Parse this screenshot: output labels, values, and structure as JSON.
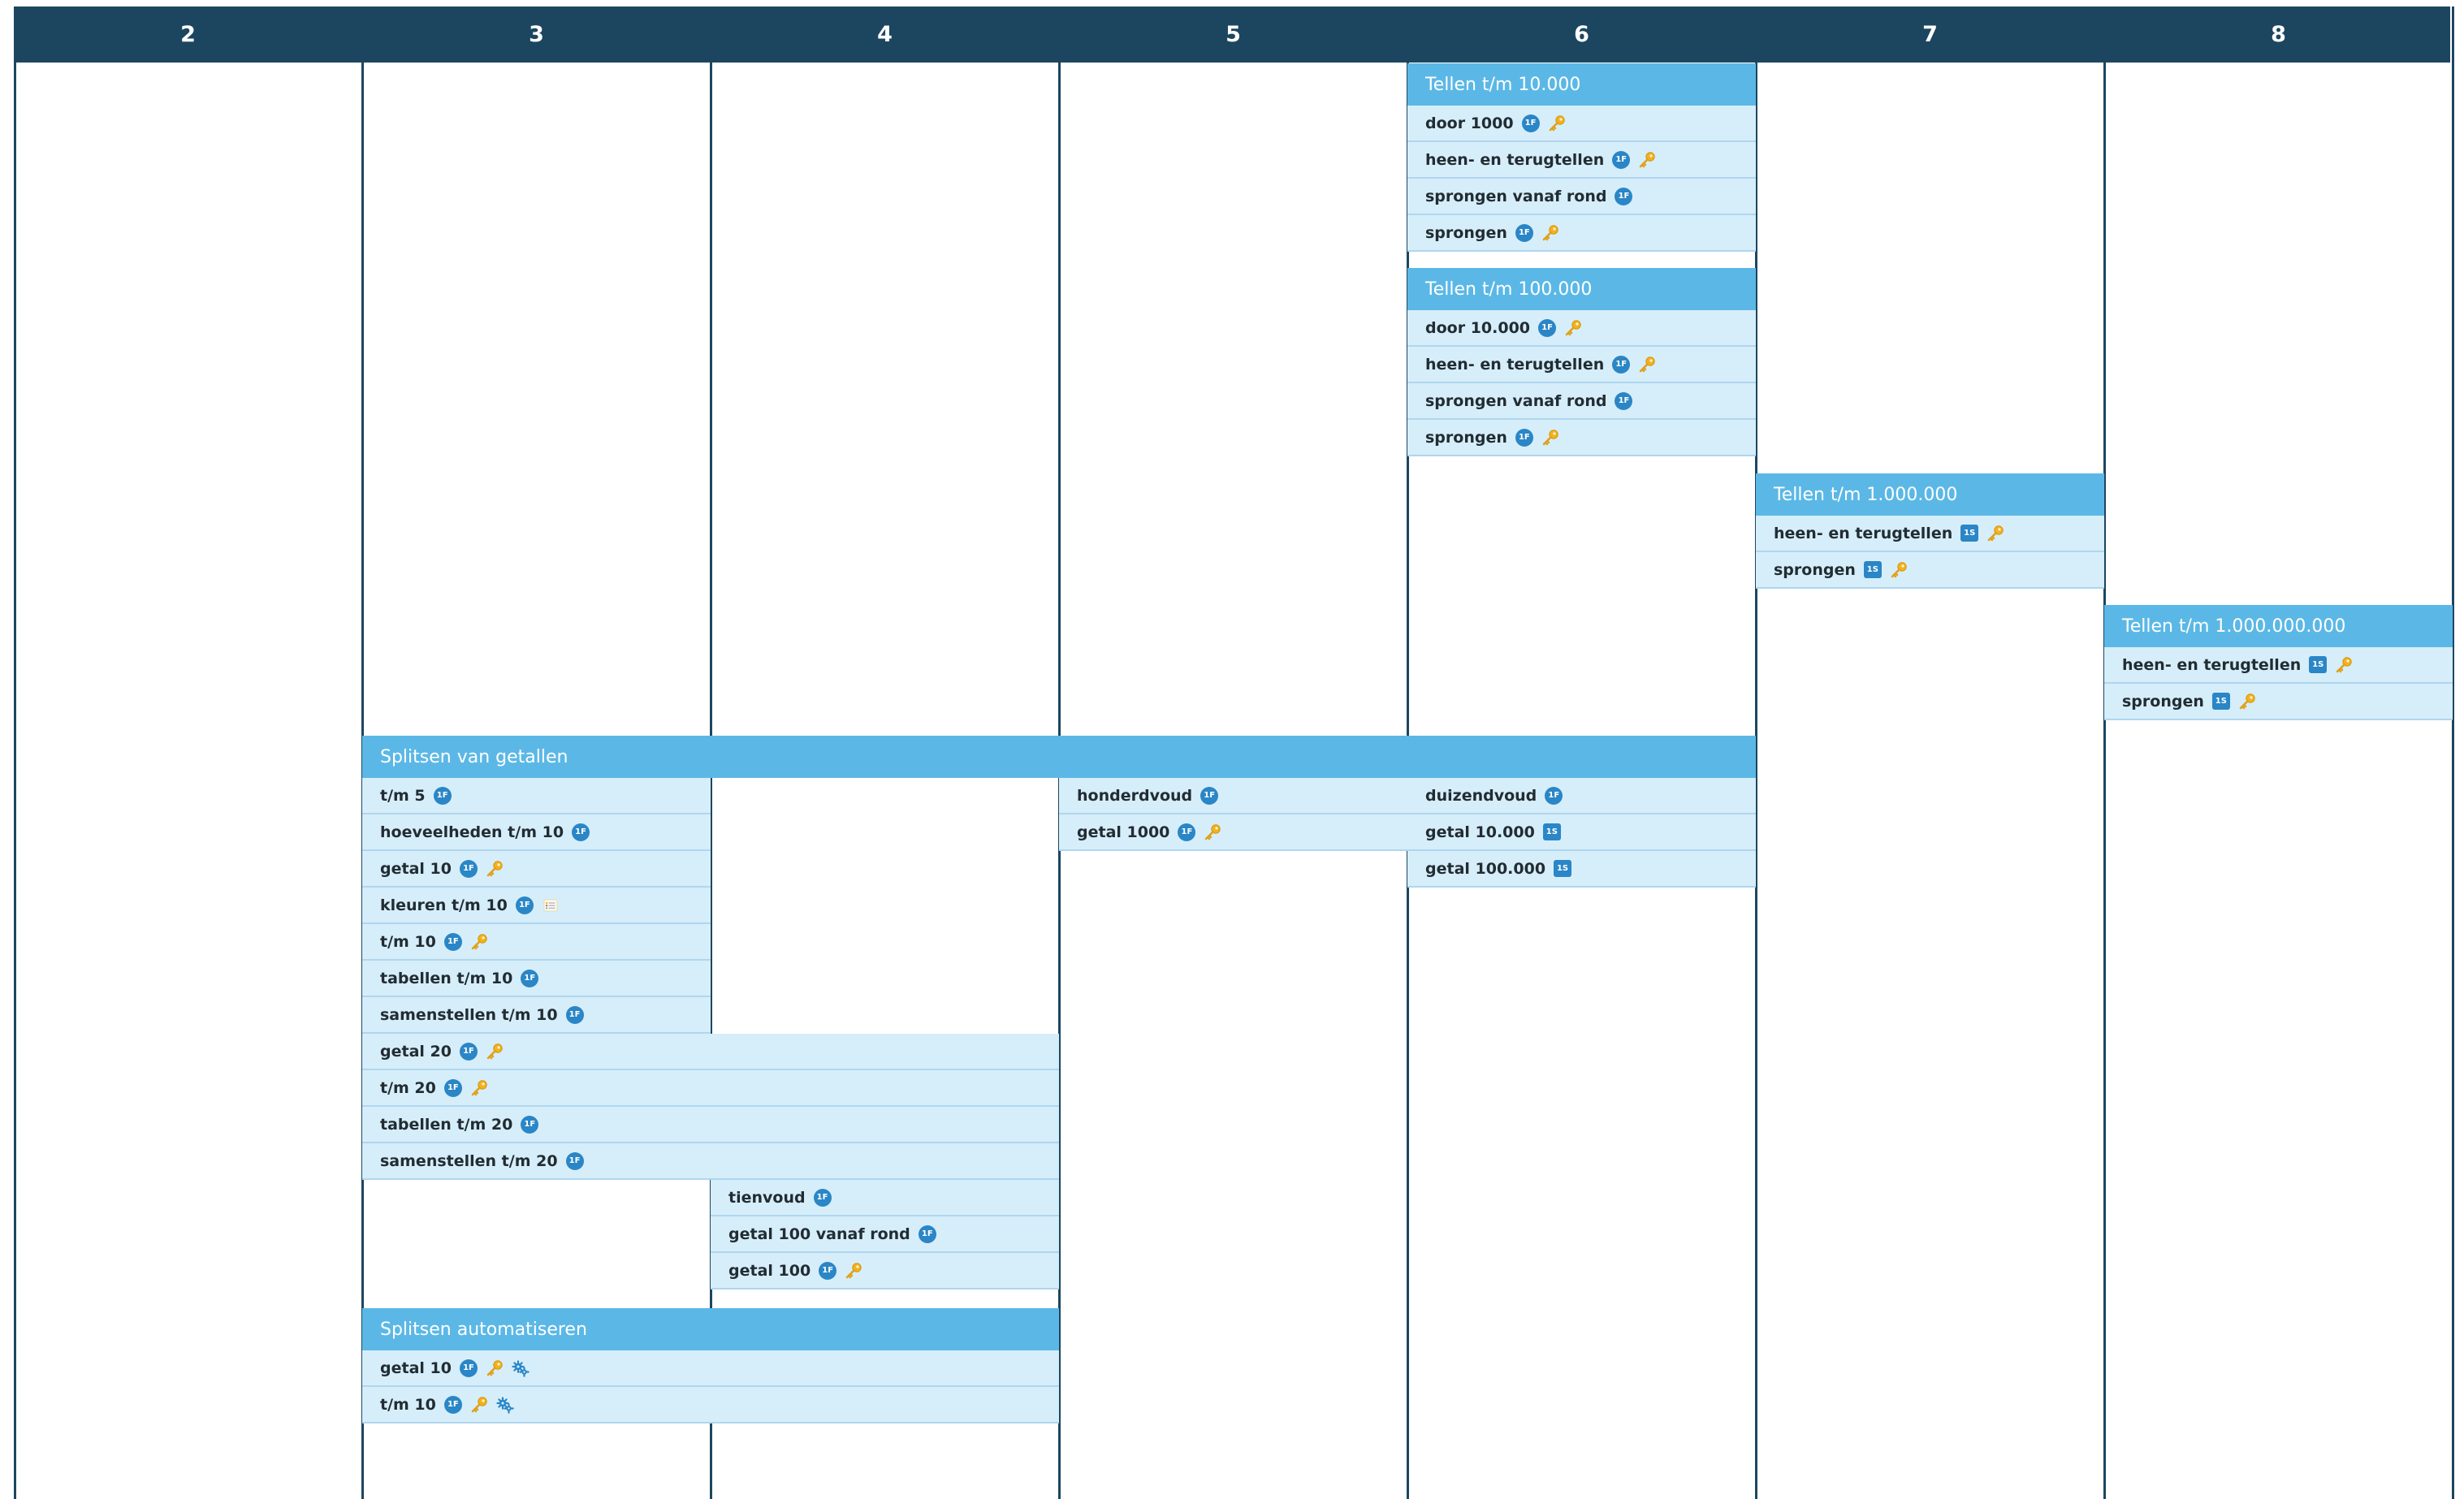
{
  "columns": [
    "2",
    "3",
    "4",
    "5",
    "6",
    "7",
    "8"
  ],
  "groups": {
    "tellen_10000": {
      "title": "Tellen t/m 10.000",
      "items": [
        {
          "label": "door 1000",
          "icons": [
            "circle-badge",
            "key"
          ]
        },
        {
          "label": "heen- en terugtellen",
          "icons": [
            "circle-badge",
            "key"
          ]
        },
        {
          "label": "sprongen vanaf rond",
          "icons": [
            "circle-badge"
          ]
        },
        {
          "label": "sprongen",
          "icons": [
            "circle-badge",
            "key"
          ]
        }
      ]
    },
    "tellen_100000": {
      "title": "Tellen t/m 100.000",
      "items": [
        {
          "label": "door 10.000",
          "icons": [
            "circle-badge",
            "key"
          ]
        },
        {
          "label": "heen- en terugtellen",
          "icons": [
            "circle-badge",
            "key"
          ]
        },
        {
          "label": "sprongen vanaf rond",
          "icons": [
            "circle-badge"
          ]
        },
        {
          "label": "sprongen",
          "icons": [
            "circle-badge",
            "key"
          ]
        }
      ]
    },
    "tellen_1000000": {
      "title": "Tellen t/m 1.000.000",
      "items": [
        {
          "label": "heen- en terugtellen",
          "icons": [
            "square-badge",
            "key"
          ]
        },
        {
          "label": "sprongen",
          "icons": [
            "square-badge",
            "key"
          ]
        }
      ]
    },
    "tellen_1000000000": {
      "title": "Tellen t/m 1.000.000.000",
      "items": [
        {
          "label": "heen- en terugtellen",
          "icons": [
            "square-badge",
            "key"
          ]
        },
        {
          "label": "sprongen",
          "icons": [
            "square-badge",
            "key"
          ]
        }
      ]
    },
    "splitsen": {
      "title": "Splitsen van getallen",
      "items_col3": [
        {
          "label": "t/m 5",
          "icons": [
            "circle-badge"
          ]
        },
        {
          "label": "hoeveelheden t/m 10",
          "icons": [
            "circle-badge"
          ]
        },
        {
          "label": "getal 10",
          "icons": [
            "circle-badge",
            "key"
          ]
        },
        {
          "label": "kleuren t/m 10",
          "icons": [
            "circle-badge",
            "list"
          ]
        },
        {
          "label": "t/m 10",
          "icons": [
            "circle-badge",
            "key"
          ]
        },
        {
          "label": "tabellen t/m 10",
          "icons": [
            "circle-badge"
          ]
        },
        {
          "label": "samenstellen t/m 10",
          "icons": [
            "circle-badge"
          ]
        }
      ],
      "items_col3_4": [
        {
          "label": "getal 20",
          "icons": [
            "circle-badge",
            "key"
          ]
        },
        {
          "label": "t/m 20",
          "icons": [
            "circle-badge",
            "key"
          ]
        },
        {
          "label": "tabellen t/m 20",
          "icons": [
            "circle-badge"
          ]
        },
        {
          "label": "samenstellen t/m 20",
          "icons": [
            "circle-badge"
          ]
        }
      ],
      "items_col4": [
        {
          "label": "tienvoud",
          "icons": [
            "circle-badge"
          ]
        },
        {
          "label": "getal 100 vanaf rond",
          "icons": [
            "circle-badge"
          ]
        },
        {
          "label": "getal 100",
          "icons": [
            "circle-badge",
            "key"
          ]
        }
      ],
      "items_col5": [
        {
          "label": "honderdvoud",
          "icons": [
            "circle-badge"
          ]
        },
        {
          "label": "getal 1000",
          "icons": [
            "circle-badge",
            "key"
          ]
        }
      ],
      "items_col6": [
        {
          "label": "duizendvoud",
          "icons": [
            "circle-badge"
          ]
        },
        {
          "label": "getal 10.000",
          "icons": [
            "square-badge"
          ]
        },
        {
          "label": "getal 100.000",
          "icons": [
            "square-badge"
          ]
        }
      ]
    },
    "automatiseren": {
      "title": "Splitsen automatiseren",
      "items": [
        {
          "label": "getal 10",
          "icons": [
            "circle-badge",
            "key",
            "gear"
          ]
        },
        {
          "label": "t/m 10",
          "icons": [
            "circle-badge",
            "key",
            "gear"
          ]
        }
      ]
    }
  },
  "badges": {
    "circle": "1F",
    "square": "1S"
  },
  "colors": {
    "header": "#1c4660",
    "group_header": "#5bb8e6",
    "item_bg": "#d6eefa",
    "badge": "#2a86c6",
    "key": "#f2b21d"
  }
}
